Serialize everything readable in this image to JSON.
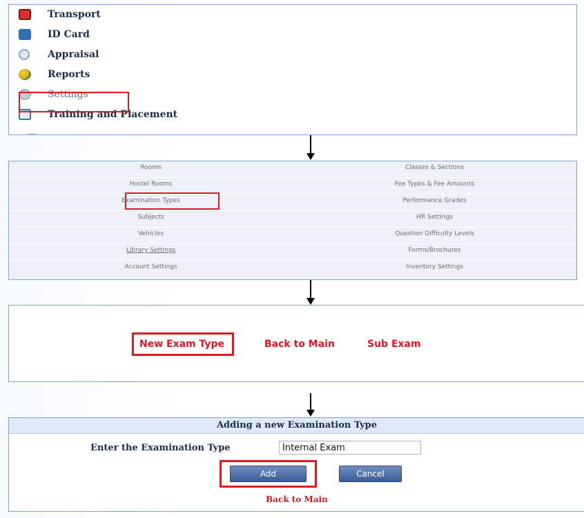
{
  "menu": {
    "items": [
      {
        "label": "Transport",
        "icon": "bus-icon",
        "color": "#d9302a"
      },
      {
        "label": "ID Card",
        "icon": "id-card-icon",
        "color": "#2f6fb5"
      },
      {
        "label": "Appraisal",
        "icon": "magnifier-icon",
        "color": "#8aa9c9"
      },
      {
        "label": "Reports",
        "icon": "reports-icon",
        "color": "#e0a21a"
      },
      {
        "label": "Settings",
        "icon": "gear-icon",
        "color": "#9aa4ae"
      },
      {
        "label": "Training and Placement",
        "icon": "training-icon",
        "color": "#3a6ea8"
      }
    ]
  },
  "settings_grid": {
    "rows": [
      {
        "left": "Rooms",
        "right": "Classes & Sections"
      },
      {
        "left": "Hostel Rooms",
        "right": "Fee Types & Fee Amounts"
      },
      {
        "left": "Examination Types",
        "right": "Performance Grades"
      },
      {
        "left": "Subjects",
        "right": "HR Settings"
      },
      {
        "left": "Vehicles",
        "right": "Question Difficulty Levels"
      },
      {
        "left": "Library Settings",
        "right": "Forms/Brochures"
      },
      {
        "left": "Account Settings",
        "right": "Inventory Settings"
      }
    ]
  },
  "links": {
    "new_exam_type": "New Exam Type",
    "back_to_main": "Back to Main",
    "sub_exam": "Sub Exam"
  },
  "form": {
    "title": "Adding a new Examination Type",
    "label": "Enter the Examination Type",
    "value": "Internal Exam",
    "add_label": "Add",
    "cancel_label": "Cancel",
    "back_label": "Back to Main"
  },
  "colors": {
    "highlight": "#e0181f",
    "border": "#7fa6d6",
    "button": "#3a5b94"
  }
}
